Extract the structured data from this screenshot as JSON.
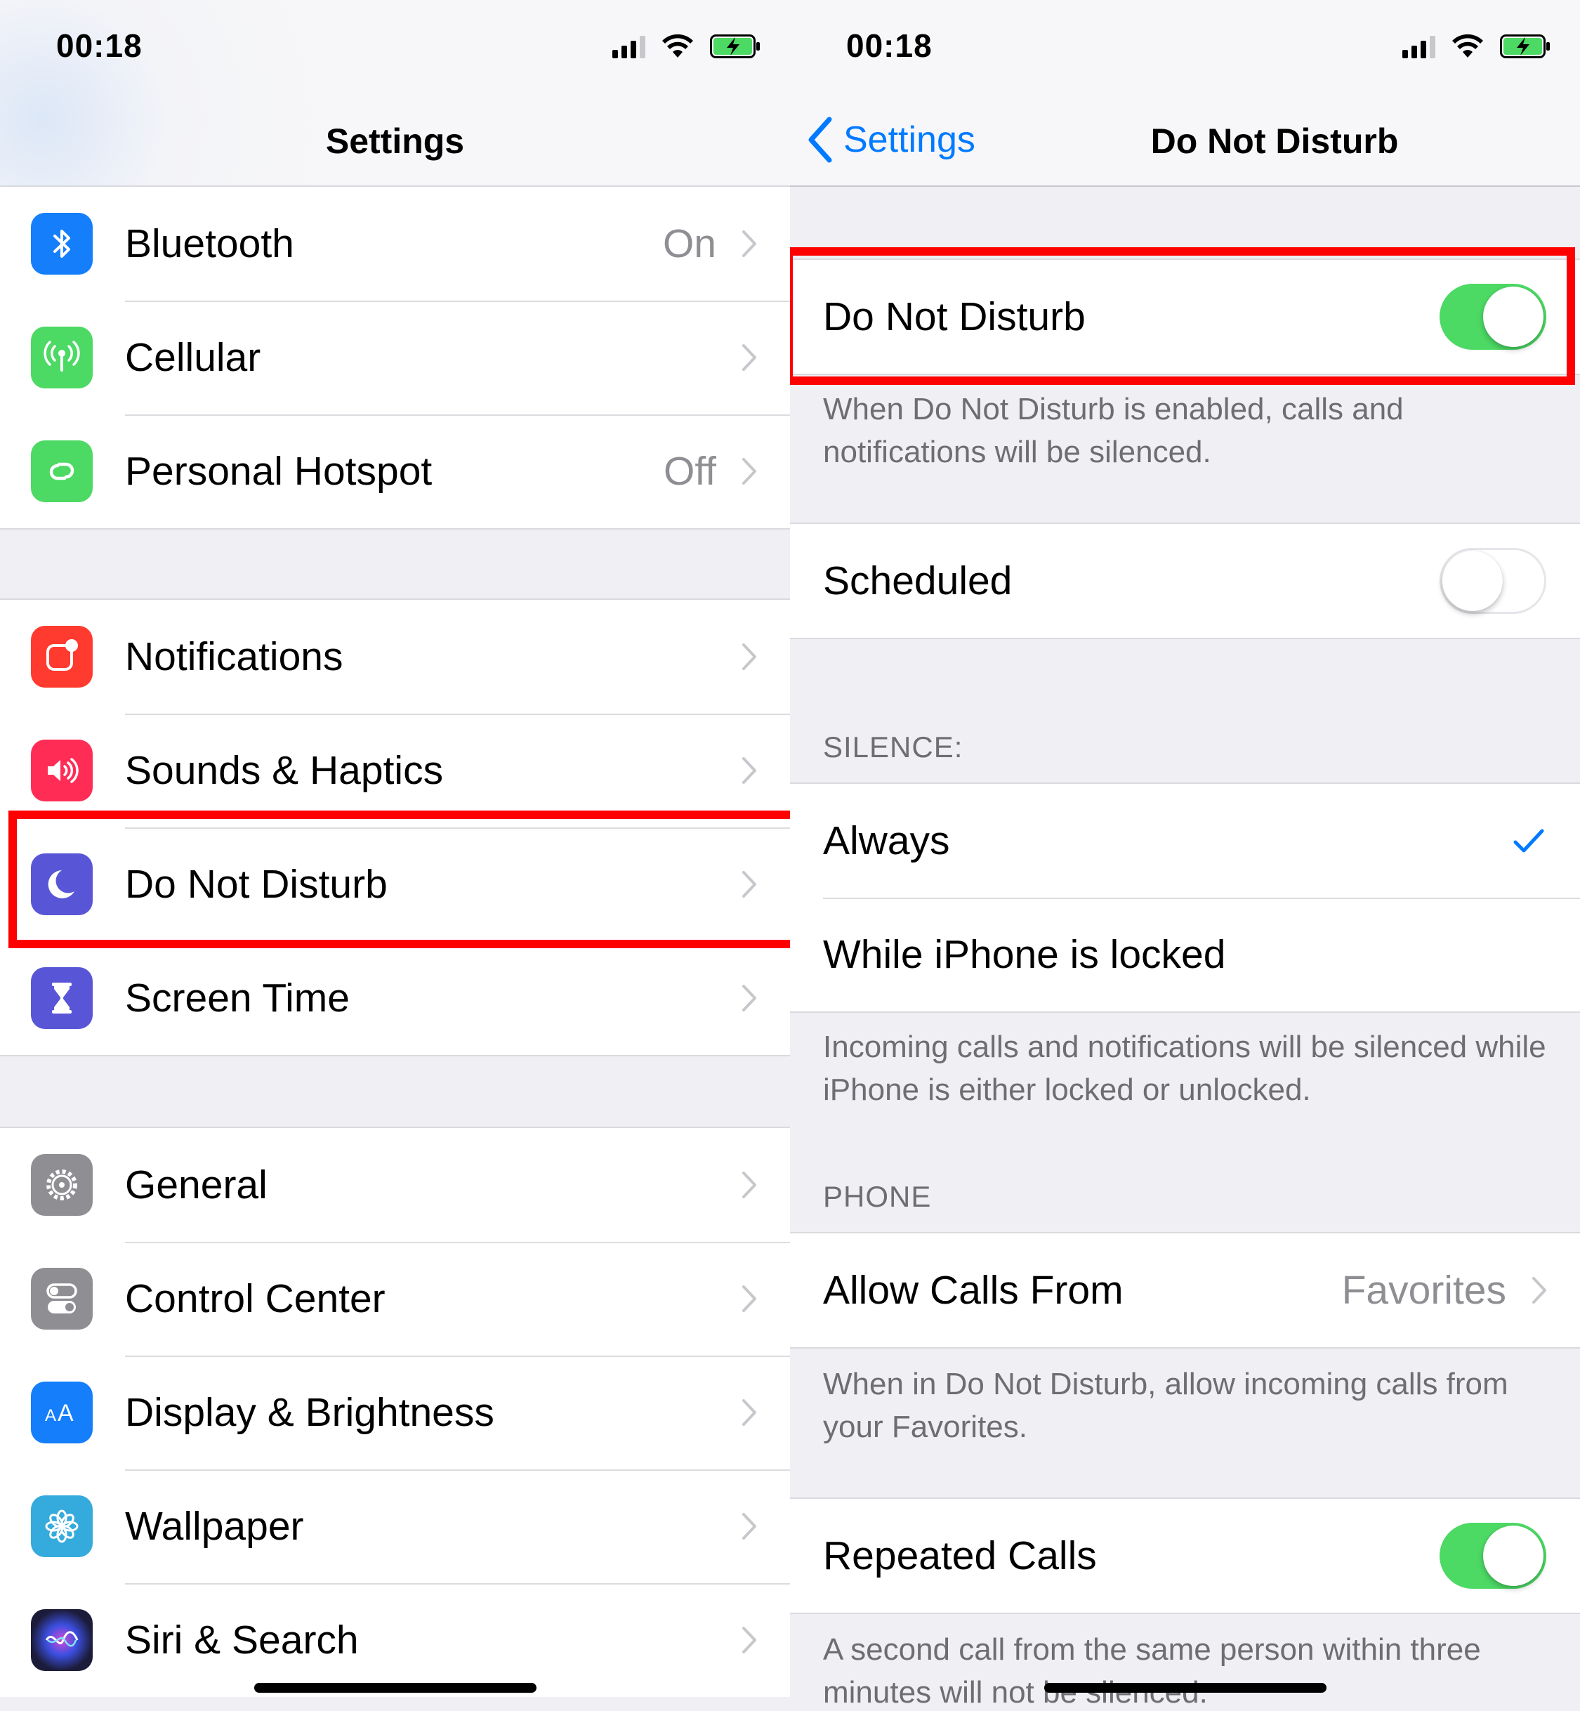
{
  "left": {
    "status": {
      "time": "00:18"
    },
    "nav": {
      "title": "Settings"
    },
    "groups": [
      [
        {
          "label": "Bluetooth",
          "value": "On",
          "icon": "bluetooth-icon",
          "color": "#147efb"
        },
        {
          "label": "Cellular",
          "value": "",
          "icon": "antenna-icon",
          "color": "#4cd964"
        },
        {
          "label": "Personal Hotspot",
          "value": "Off",
          "icon": "hotspot-icon",
          "color": "#4cd964"
        }
      ],
      [
        {
          "label": "Notifications",
          "value": "",
          "icon": "notifications-icon",
          "color": "#ff3b30"
        },
        {
          "label": "Sounds & Haptics",
          "value": "",
          "icon": "speaker-icon",
          "color": "#ff2d55"
        },
        {
          "label": "Do Not Disturb",
          "value": "",
          "icon": "moon-icon",
          "color": "#5856d6"
        },
        {
          "label": "Screen Time",
          "value": "",
          "icon": "hourglass-icon",
          "color": "#5856d6"
        }
      ],
      [
        {
          "label": "General",
          "value": "",
          "icon": "gear-icon",
          "color": "#8e8e93"
        },
        {
          "label": "Control Center",
          "value": "",
          "icon": "switches-icon",
          "color": "#8e8e93"
        },
        {
          "label": "Display & Brightness",
          "value": "",
          "icon": "text-size-icon",
          "color": "#147efb"
        },
        {
          "label": "Wallpaper",
          "value": "",
          "icon": "flower-icon",
          "color": "#35aadc"
        },
        {
          "label": "Siri & Search",
          "value": "",
          "icon": "siri-icon",
          "color": "#1c1c3a"
        }
      ]
    ]
  },
  "right": {
    "status": {
      "time": "00:18"
    },
    "nav": {
      "back": "Settings",
      "title": "Do Not Disturb"
    },
    "dnd": {
      "label": "Do Not Disturb",
      "enabled": true,
      "footer": "When Do Not Disturb is enabled, calls and notifications will be silenced."
    },
    "scheduled": {
      "label": "Scheduled",
      "enabled": false
    },
    "silence": {
      "header": "SILENCE:",
      "always": "Always",
      "locked": "While iPhone is locked",
      "footer": "Incoming calls and notifications will be silenced while iPhone is either locked or unlocked."
    },
    "phone": {
      "header": "PHONE",
      "allow_label": "Allow Calls From",
      "allow_value": "Favorites",
      "allow_footer": "When in Do Not Disturb, allow incoming calls from your Favorites.",
      "repeated_label": "Repeated Calls",
      "repeated_enabled": true,
      "repeated_footer": "A second call from the same person within three minutes will not be silenced."
    }
  },
  "colors": {
    "accent": "#007aff",
    "toggle_on": "#4cd964",
    "highlight": "#ff0000"
  }
}
